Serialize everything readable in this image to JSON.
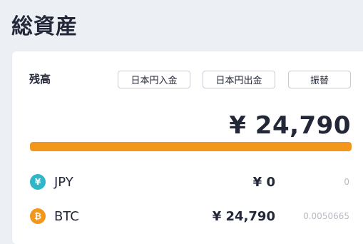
{
  "page": {
    "title": "総資産"
  },
  "balance": {
    "label": "残高",
    "total": "¥ 24,790",
    "actions": {
      "deposit": "日本円入金",
      "withdraw": "日本円出金",
      "transfer": "振替"
    },
    "progress": {
      "fill_fraction": 1.0,
      "color": "#f2961c"
    }
  },
  "assets": [
    {
      "icon": "yen-coin-icon",
      "symbol": "¥",
      "icon_color": "#2eb6c9",
      "name": "JPY",
      "amount": "¥ 0",
      "quantity": "0"
    },
    {
      "icon": "bitcoin-coin-icon",
      "symbol": "₿",
      "icon_color": "#f2961c",
      "name": "BTC",
      "amount": "¥ 24,790",
      "quantity": "0.0050665"
    }
  ]
}
